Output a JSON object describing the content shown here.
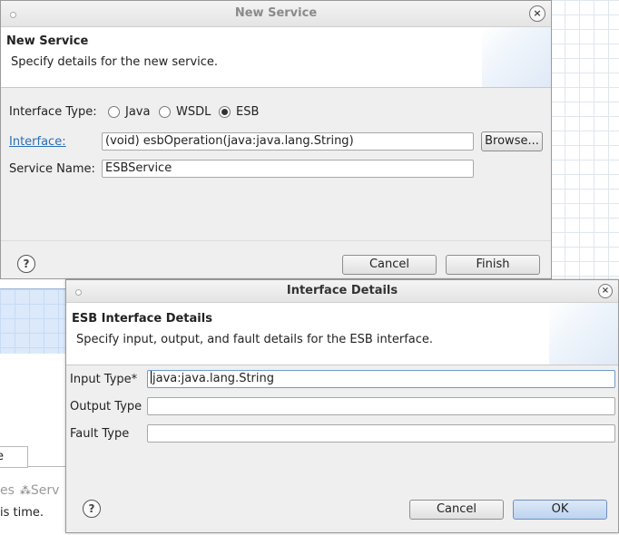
{
  "background": {
    "tab_text": "e",
    "tabs_text": "es",
    "tab_services": "Serv",
    "status_text": "is time."
  },
  "new_service": {
    "window_title": "New Service",
    "header_title": "New Service",
    "header_desc": "Specify details for the new service.",
    "interface_type_label": "Interface Type:",
    "radio_java": "Java",
    "radio_wsdl": "WSDL",
    "radio_esb": "ESB",
    "interface_label": "Interface:",
    "interface_value": "(void) esbOperation(java:java.lang.String)",
    "browse_label": "Browse...",
    "service_name_label": "Service Name:",
    "service_name_value": "ESBService",
    "cancel_label": "Cancel",
    "finish_label": "Finish"
  },
  "interface_details": {
    "window_title": "Interface Details",
    "header_title": "ESB Interface Details",
    "header_desc": "Specify input, output, and fault details for the ESB interface.",
    "input_type_label": "Input Type*",
    "input_type_value": "java:java.lang.String",
    "output_type_label": "Output Type",
    "output_type_value": "",
    "fault_type_label": "Fault Type",
    "fault_type_value": "",
    "cancel_label": "Cancel",
    "ok_label": "OK"
  },
  "icons": {
    "help": "?",
    "close": "×",
    "services": "⁂"
  }
}
